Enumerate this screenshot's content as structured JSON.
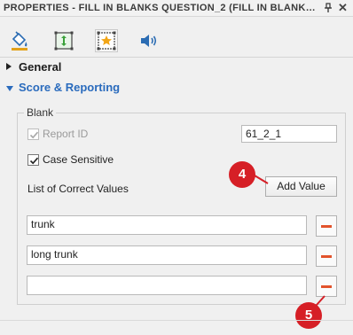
{
  "window": {
    "title": "PROPERTIES - FILL IN BLANKS QUESTION_2 (FILL IN BLANKS QUES...",
    "pin_icon": "pin-icon",
    "close_glyph": "✕"
  },
  "tabs": [
    {
      "icon": "paint-bucket-icon"
    },
    {
      "icon": "resize-frame-icon"
    },
    {
      "icon": "star-frame-icon",
      "active": true
    },
    {
      "icon": "speaker-icon"
    }
  ],
  "sections": {
    "general": "General",
    "score_reporting": "Score & Reporting"
  },
  "blank_group": {
    "legend": "Blank",
    "report_id_label": "Report ID",
    "report_id_checked": true,
    "report_id_value": "61_2_1",
    "case_sensitive_label": "Case Sensitive",
    "case_sensitive_checked": true,
    "list_label": "List of Correct Values",
    "add_value_label": "Add Value",
    "values": [
      "trunk",
      "long trunk",
      ""
    ]
  },
  "callouts": {
    "four": "4",
    "five": "5"
  },
  "colors": {
    "accent": "#2a6bbd",
    "callout": "#d61f26",
    "remove": "#e2522b"
  }
}
